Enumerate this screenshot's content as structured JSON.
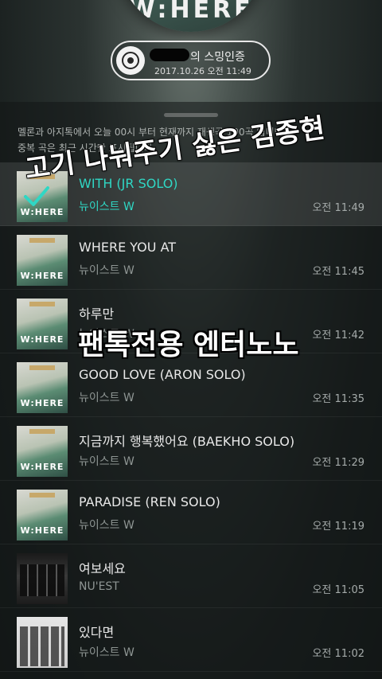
{
  "header": {
    "cover_word": "W:HERE",
    "cert_title": "의 스밍인증",
    "cert_date": "2017.10.26 오전 11:49"
  },
  "notice": {
    "line1": "멜론과 아지톡에서 오늘 00시 부터 현재까지 재생곡 100곡 입니다.",
    "line2": "중복 곡은 최근 시간만 표시됩니다."
  },
  "thumb_word": "W:HERE",
  "songs": [
    {
      "title": "WITH (JR SOLO)",
      "artist": "뉴이스트 W",
      "time": "오전 11:49"
    },
    {
      "title": "WHERE YOU AT",
      "artist": "뉴이스트 W",
      "time": "오전 11:45"
    },
    {
      "title": "하루만",
      "artist": "뉴이스트 W",
      "time": "오전 11:42"
    },
    {
      "title": "GOOD LOVE (ARON SOLO)",
      "artist": "뉴이스트 W",
      "time": "오전 11:35"
    },
    {
      "title": "지금까지 행복했어요 (BAEKHO SOLO)",
      "artist": "뉴이스트 W",
      "time": "오전 11:29"
    },
    {
      "title": "PARADISE (REN SOLO)",
      "artist": "뉴이스트 W",
      "time": "오전 11:19"
    },
    {
      "title": "여보세요",
      "artist": "NU'EST",
      "time": "오전 11:05"
    },
    {
      "title": "있다면",
      "artist": "뉴이스트 W",
      "time": "오전 11:02"
    }
  ],
  "overlays": {
    "caption1": "고기 나눠주기 싫은 김종현",
    "caption2": "팬톡전용 엔터노노"
  },
  "colors": {
    "accent": "#2fd7c4",
    "background": "#1d2422"
  }
}
